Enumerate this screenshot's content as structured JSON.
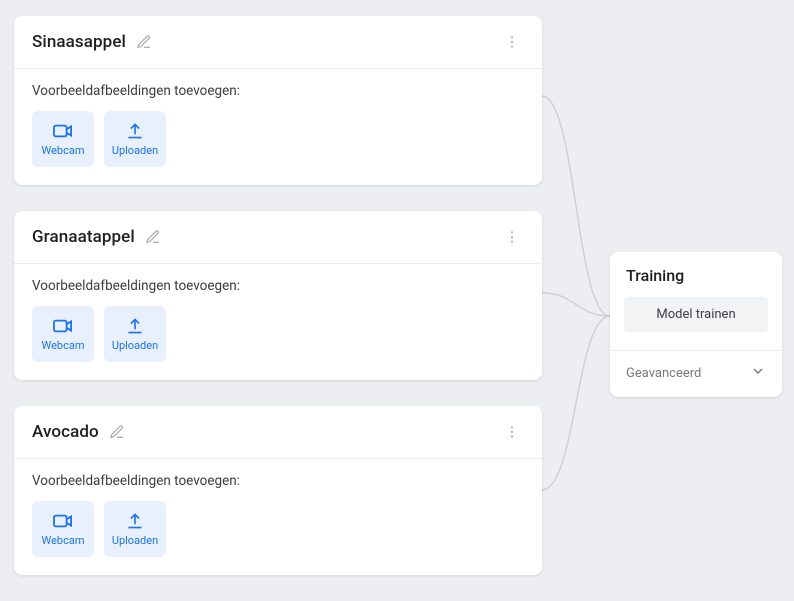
{
  "classes": [
    {
      "name": "Sinaasappel",
      "add_label": "Voorbeeldafbeeldingen toevoegen:",
      "webcam_label": "Webcam",
      "upload_label": "Uploaden"
    },
    {
      "name": "Granaatappel",
      "add_label": "Voorbeeldafbeeldingen toevoegen:",
      "webcam_label": "Webcam",
      "upload_label": "Uploaden"
    },
    {
      "name": "Avocado",
      "add_label": "Voorbeeldafbeeldingen toevoegen:",
      "webcam_label": "Webcam",
      "upload_label": "Uploaden"
    }
  ],
  "training": {
    "title": "Training",
    "train_button": "Model trainen",
    "advanced": "Geavanceerd"
  },
  "colors": {
    "accent": "#1a73e8",
    "accent_bg": "#e8f0fe"
  }
}
